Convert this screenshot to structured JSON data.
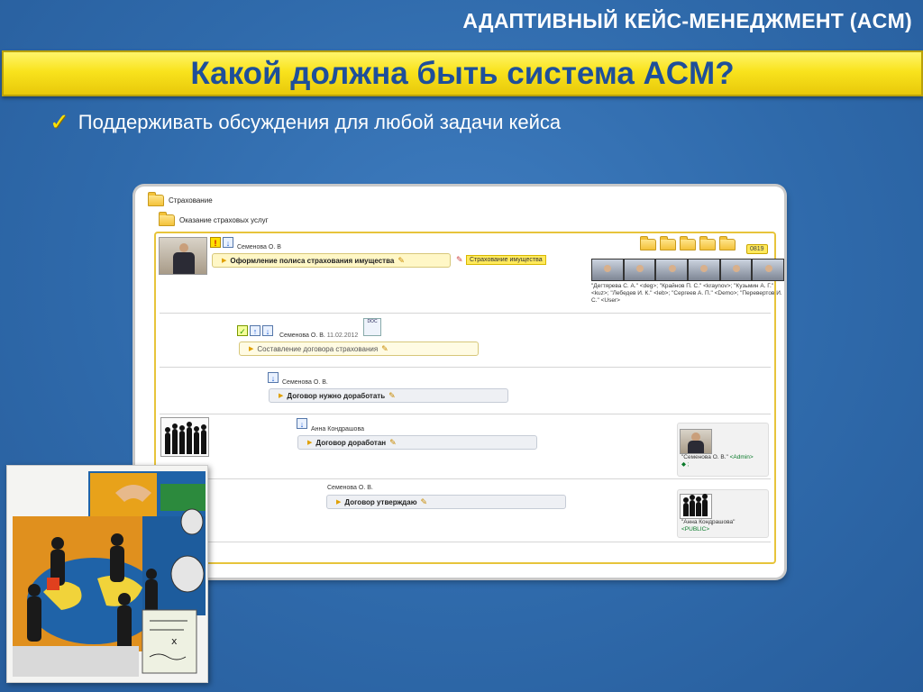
{
  "slide": {
    "header_title": "АДАПТИВНЫЙ КЕЙС-МЕНЕДЖМЕНТ (ACM)",
    "main_title": "Какой должна быть система ACM?",
    "bullet": "Поддерживать обсуждения для любой задачи кейса"
  },
  "app": {
    "root_folder": "Страхование",
    "sub_folder": "Оказание страховых услуг",
    "counter": "0819",
    "item1": {
      "author": "Семенова О. В",
      "task": "Оформление полиса страхования имущества",
      "tag": "Страхование имущества",
      "users": "\"Дегтярева С. А.\" <deg>; \"Крайнов П. С.\" <kraynov>; \"Кузьмин А. Г.\" <kuz>; \"Лебедев И. К.\" <leb>; \"Сергеев А. П.\" <Demo>; \"Перевертов И. С.\" <User>"
    },
    "item2": {
      "author": "Семенова О. В.",
      "date": "11.02.2012",
      "task": "Составление договора страхования",
      "doc_label": "DOC"
    },
    "item3": {
      "author": "Семенова О. В.",
      "task": "Договор нужно доработать"
    },
    "item4": {
      "author": "Анна Кондрашова",
      "task": "Договор доработан",
      "side_user": "\"Семенова О. В.\"",
      "side_login": "<Admin>",
      "side_extra": "◆ ;"
    },
    "item5": {
      "author": "Семенова О. В.",
      "task": "Договор утверждаю",
      "side_user": "\"Анна Кондрашова\"",
      "side_login": "<PUBLIC>"
    }
  },
  "colors": {
    "accent_yellow": "#f9e31d",
    "title_blue": "#1e4f9a",
    "background": "#2f6aab"
  }
}
